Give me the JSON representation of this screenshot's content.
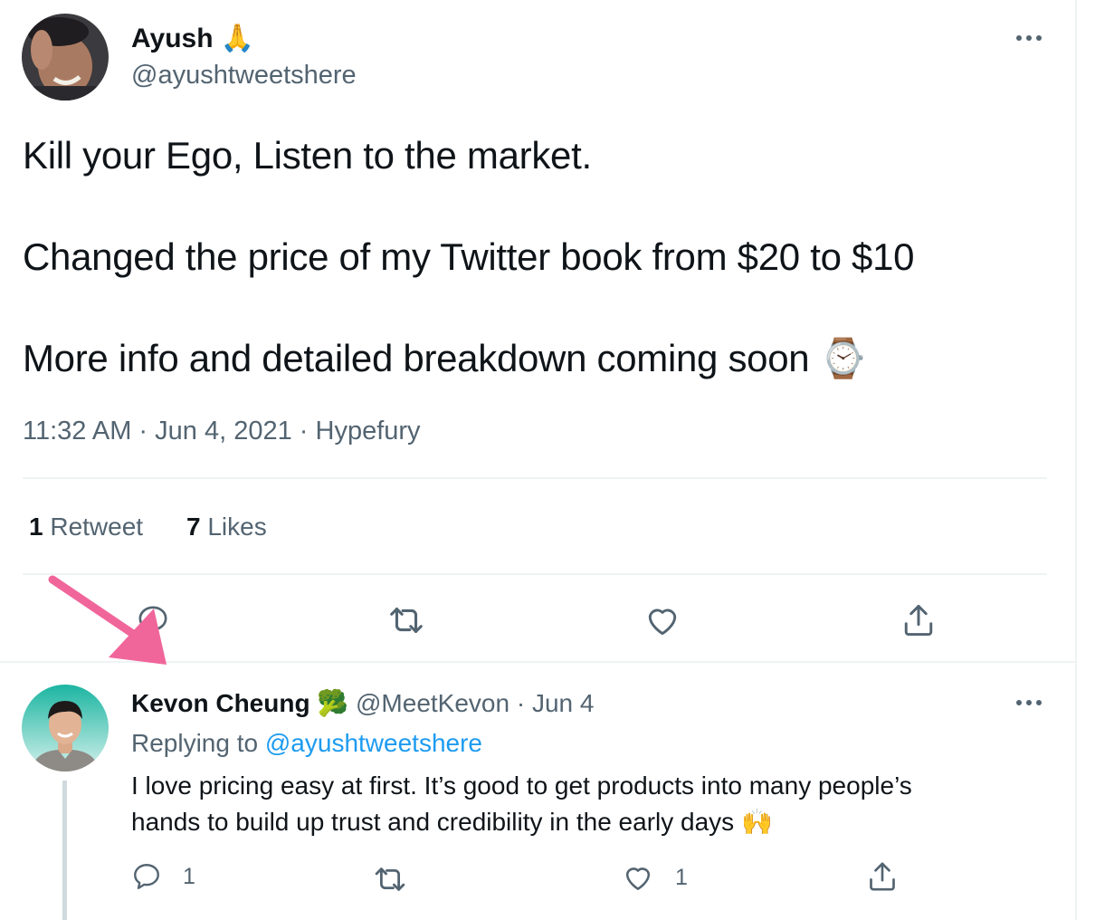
{
  "main_tweet": {
    "author_name": "Ayush",
    "author_emoji": "🙏",
    "author_handle": "@ayushtweetshere",
    "lines": [
      "Kill your Ego, Listen to the market.",
      "Changed the price of my Twitter book from $20 to $10",
      "More info and detailed breakdown coming soon"
    ],
    "trailing_emoji": "⌚",
    "timestamp": "11:32 AM · Jun 4, 2021",
    "separator": " · ",
    "source": "Hypefury",
    "retweets_count": "1",
    "retweets_label": "Retweet",
    "likes_count": "7",
    "likes_label": "Likes"
  },
  "reply": {
    "author_name": "Kevon Cheung",
    "author_emoji": "🥦",
    "author_handle": "@MeetKevon",
    "date": "· Jun 4",
    "replying_prefix": "Replying to",
    "replying_handle": "@ayushtweetshere",
    "text_line1": "I love pricing easy at first. It’s good to get products into many people’s",
    "text_line2": "hands to build up trust and credibility in the early days",
    "text_emoji": "🙌",
    "reply_count": "1",
    "like_count": "1"
  },
  "icons": {
    "more": "more-icon",
    "reply": "reply-icon",
    "retweet": "retweet-icon",
    "like": "heart-icon",
    "share": "share-icon",
    "annotation": "arrow-icon"
  },
  "colors": {
    "text": "#0f1419",
    "muted": "#536471",
    "link": "#1d9bf0",
    "divider": "#eff3f4",
    "annotation_arrow": "#f0669b"
  }
}
